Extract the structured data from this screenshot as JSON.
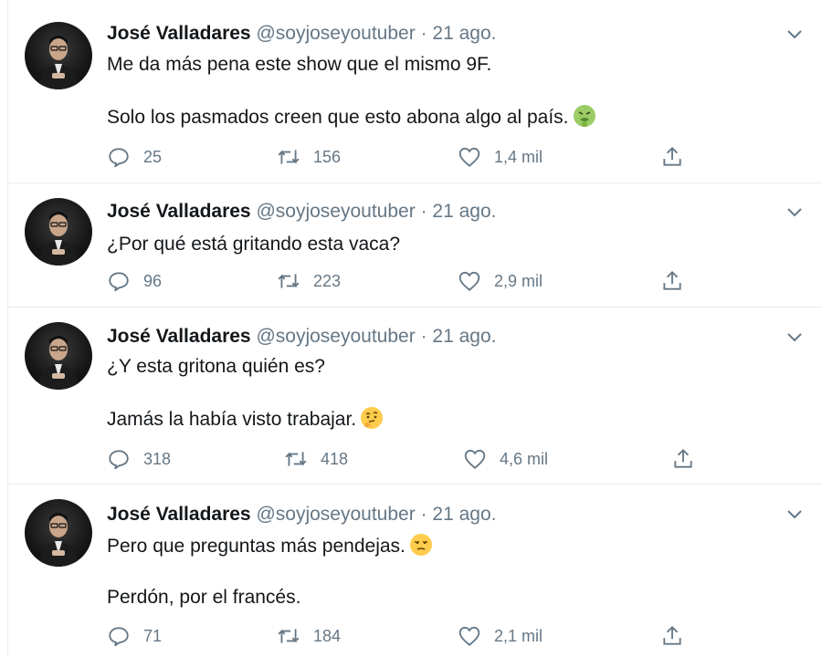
{
  "tweets": [
    {
      "name": "José Valladares",
      "handle": "@soyjoseyoutuber",
      "dot": "·",
      "date": "21 ago.",
      "paragraphs": [
        "Me da más pena este show que el mismo 9F.",
        "Solo los pasmados creen que esto abona algo al país."
      ],
      "emoji": "nauseated-face",
      "replies": "25",
      "retweets": "156",
      "likes": "1,4 mil"
    },
    {
      "name": "José Valladares",
      "handle": "@soyjoseyoutuber",
      "dot": "·",
      "date": "21 ago.",
      "paragraphs": [
        "¿Por qué está gritando esta vaca?"
      ],
      "emoji": "",
      "replies": "96",
      "retweets": "223",
      "likes": "2,9 mil"
    },
    {
      "name": "José Valladares",
      "handle": "@soyjoseyoutuber",
      "dot": "·",
      "date": "21 ago.",
      "paragraphs": [
        "¿Y esta gritona quién es?",
        "Jamás la había visto trabajar."
      ],
      "emoji": "thinking-face",
      "replies": "318",
      "retweets": "418",
      "likes": "4,6 mil"
    },
    {
      "name": "José Valladares",
      "handle": "@soyjoseyoutuber",
      "dot": "·",
      "date": "21 ago.",
      "paragraphs": [
        "Pero que preguntas más pendejas.",
        "Perdón, por el francés."
      ],
      "emoji": "unamused-face",
      "replies": "71",
      "retweets": "184",
      "likes": "2,1 mil"
    }
  ],
  "colors": {
    "text": "#14171a",
    "secondary": "#657786",
    "border": "#e6ecf0"
  }
}
